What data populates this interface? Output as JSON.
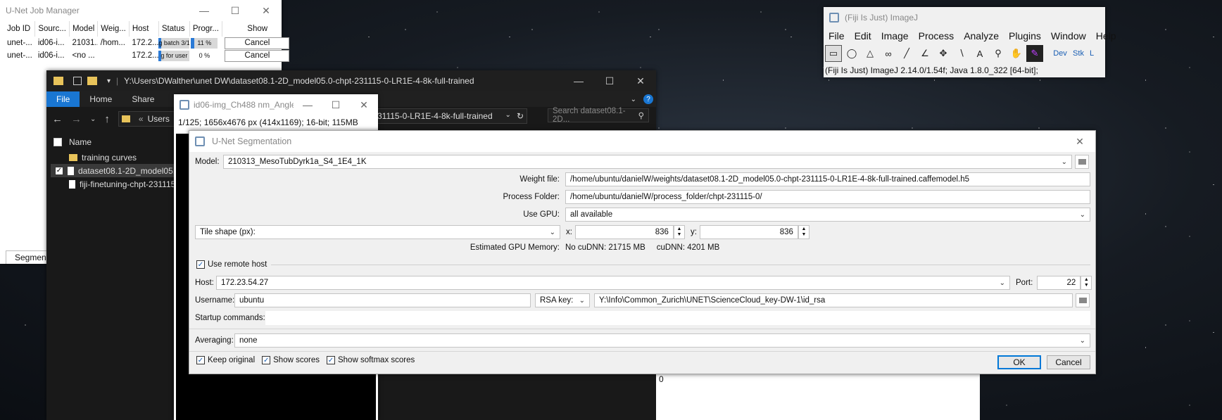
{
  "job_manager": {
    "title": "U-Net Job Manager",
    "columns": [
      "Job ID",
      "Sourc...",
      "Model",
      "Weig...",
      "Host",
      "Status",
      "Progr...",
      "Show"
    ],
    "rows": [
      {
        "job_id": "unet-...",
        "source": "id06-i...",
        "model": "21031...",
        "weights": "/hom...",
        "host": "172.2...",
        "status": "g batch 3/1",
        "progress": "11 %",
        "progress_value": 0.11,
        "show": "Cancel"
      },
      {
        "job_id": "unet-...",
        "source": "id06-i...",
        "model": "<no ...",
        "weights": "",
        "host": "172.2...",
        "status": "g for user",
        "progress": "0 %",
        "progress_value": 0.0,
        "show": "Cancel"
      }
    ],
    "bottom_tab": "Segmenta"
  },
  "explorer": {
    "title": "Y:\\Users\\DWalther\\unet DW\\dataset08.1-2D_model05.0-chpt-231115-0-LR1E-4-8k-full-trained",
    "ribbon_tabs": [
      "File",
      "Home",
      "Share",
      "Vi"
    ],
    "address_parts": [
      "«",
      "Users"
    ],
    "address_tail": "31115-0-LR1E-4-8k-full-trained",
    "search_placeholder": "Search dataset08.1-2D...",
    "column_name": "Name",
    "items": [
      {
        "name": "training curves",
        "type": "folder"
      },
      {
        "name": "dataset08.1-2D_model05.0-c",
        "type": "file",
        "selected": true
      },
      {
        "name": "fiji-finetuning-chpt-231115-",
        "type": "file"
      }
    ]
  },
  "imagej": {
    "title": "(Fiji Is Just) ImageJ",
    "menus": [
      "File",
      "Edit",
      "Image",
      "Process",
      "Analyze",
      "Plugins",
      "Window",
      "Help"
    ],
    "tools": [
      "rectangle-icon",
      "oval-icon",
      "polygon-icon",
      "freehand-icon",
      "line-icon",
      "angle-icon",
      "point-icon",
      "wand-icon",
      "text-icon",
      "magnifier-icon",
      "hand-icon",
      "color-picker-icon"
    ],
    "extra_tools": [
      "Dev",
      "Stk",
      "L"
    ],
    "status": "(Fiji Is Just) ImageJ 2.14.0/1.54f; Java 1.8.0_322 [64-bit];"
  },
  "image_window": {
    "title": "id06-img_Ch488 nm_Angle...",
    "info": "1/125; 1656x4676 px (414x1169); 16-bit; 115MB"
  },
  "unet": {
    "title": "U-Net Segmentation",
    "model_label": "Model:",
    "model_value": "210313_MesoTubDyrk1a_S4_1E4_1K",
    "weight_label": "Weight file:",
    "weight_value": "/home/ubuntu/danielW/weights/dataset08.1-2D_model05.0-chpt-231115-0-LR1E-4-8k-full-trained.caffemodel.h5",
    "process_label": "Process Folder:",
    "process_value": "/home/ubuntu/danielW/process_folder/chpt-231115-0/",
    "gpu_label": "Use GPU:",
    "gpu_value": "all available",
    "tile_label": "Tile shape (px):",
    "x_label": "x:",
    "x_value": "836",
    "y_label": "y:",
    "y_value": "836",
    "mem_label": "Estimated GPU Memory:",
    "mem_no_cudnn": "No cuDNN: 21715 MB",
    "mem_cudnn": "cuDNN: 4201 MB",
    "remote_label": "Use remote host",
    "host_label": "Host:",
    "host_value": "172.23.54.27",
    "port_label": "Port:",
    "port_value": "22",
    "user_label": "Username:",
    "user_value": "ubuntu",
    "rsa_label": "RSA key:",
    "rsa_value": "Y:\\Info\\Common_Zurich\\UNET\\ScienceCloud_key-DW-1\\id_rsa",
    "startup_label": "Startup commands:",
    "averaging_label": "Averaging:",
    "averaging_value": "none",
    "keep_original": "Keep original",
    "show_scores": "Show scores",
    "show_softmax": "Show softmax scores",
    "ok": "OK",
    "cancel": "Cancel"
  },
  "stray_text": "0"
}
